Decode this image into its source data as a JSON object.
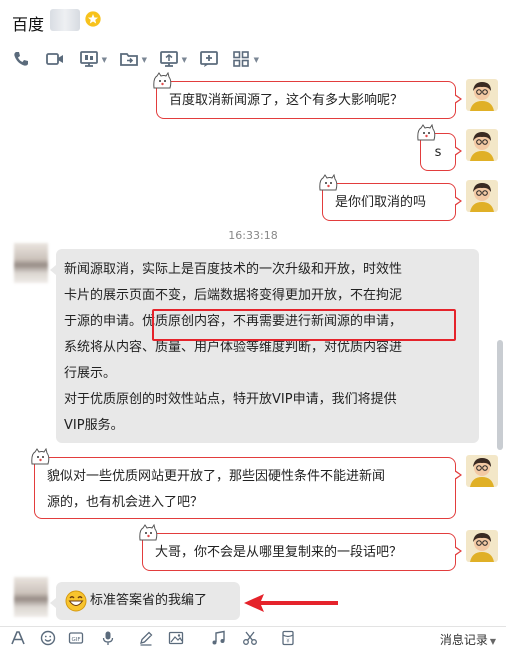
{
  "header": {
    "contact_name": "百度",
    "star_icon": "favorite-star-icon"
  },
  "toolbar": {
    "tools": [
      "phone-icon",
      "video-icon",
      "screen-share-icon",
      "file-transfer-icon",
      "remote-desktop-icon",
      "add-app-icon",
      "app-grid-icon"
    ]
  },
  "messages": [
    {
      "from": "me",
      "text": "百度取消新闻源了，这个有多大影响呢？"
    },
    {
      "from": "me",
      "text": "s"
    },
    {
      "from": "me",
      "text": "是你们取消的吗"
    },
    {
      "type": "time",
      "text": "16:33:18"
    },
    {
      "from": "other",
      "lines": [
        "新闻源取消，实际上是百度技术的一次升级和开放，时效性",
        "卡片的展示页面不变，后端数据将变得更加开放，不在拘泥",
        "于源的申请。优质原创内容，不再需要进行新闻源的申请，",
        "系统将从内容、质量、用户体验等维度判断，对优质内容进",
        "行展示。",
        "对于优质原创的时效性站点，特开放VIP申请，我们将提供",
        "VIP服务。"
      ]
    },
    {
      "from": "me",
      "lines": [
        "貌似对一些优质网站更开放了，那些因硬性条件不能进新闻",
        "源的，也有机会进入了吧？"
      ]
    },
    {
      "from": "me",
      "text": "大哥，你不会是从哪里复制来的一段话吧？"
    },
    {
      "from": "other",
      "text": "标准答案省的我编了"
    }
  ],
  "annotation": {
    "highlight_color": "#e5232b",
    "arrow_color": "#e5232b"
  },
  "bottom_bar": {
    "tools": [
      "font-icon",
      "emoji-icon",
      "gif-icon",
      "voice-icon",
      "pen-icon",
      "image-icon",
      "music-icon",
      "scissors-icon",
      "red-packet-icon"
    ],
    "history_label": "消息记录"
  },
  "colors": {
    "bubble_border": "#e23d3d",
    "incoming_bubble": "#e8e8e8"
  }
}
